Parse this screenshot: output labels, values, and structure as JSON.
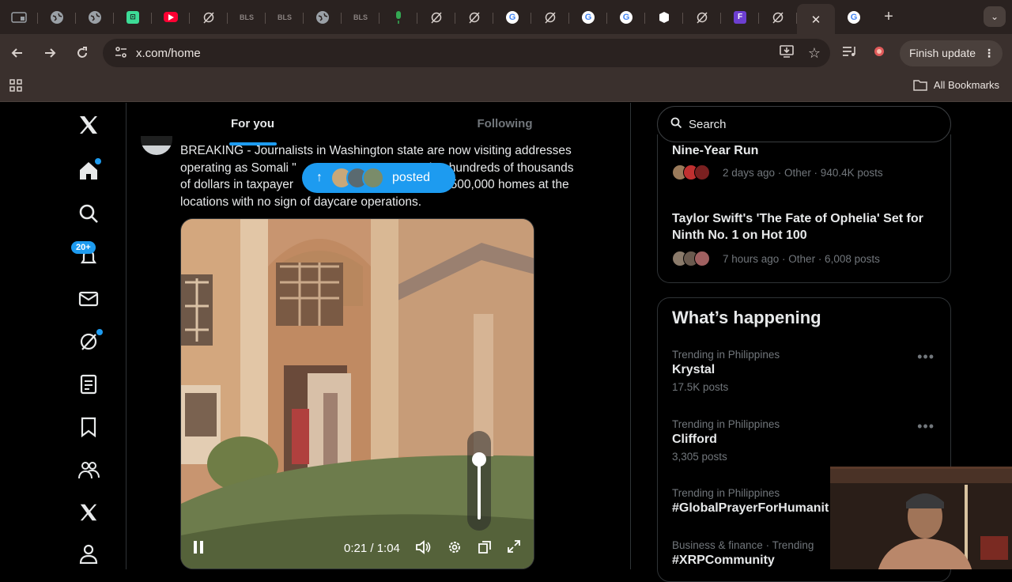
{
  "browser": {
    "tabs": [
      {
        "icon": "tablet-icon",
        "color": "#9aa0a6",
        "text": ""
      },
      {
        "icon": "globe-icon",
        "color": "#9aa0a6",
        "text": ""
      },
      {
        "icon": "globe-icon",
        "color": "#9aa0a6",
        "text": ""
      },
      {
        "icon": "chat-app-icon",
        "color": "#3ddc97",
        "text": ""
      },
      {
        "icon": "youtube-icon",
        "color": "#ff0033",
        "text": ""
      },
      {
        "icon": "grok-icon",
        "color": "#d8d0cc",
        "text": ""
      },
      {
        "icon": "bls-icon",
        "color": "#2a2220",
        "text": "BLS"
      },
      {
        "icon": "bls-icon",
        "color": "#2a2220",
        "text": "BLS"
      },
      {
        "icon": "globe-icon",
        "color": "#9aa0a6",
        "text": ""
      },
      {
        "icon": "bls-icon",
        "color": "#2a2220",
        "text": "BLS"
      },
      {
        "icon": "mic-icon",
        "color": "#34a853",
        "text": ""
      },
      {
        "icon": "grok-icon",
        "color": "#d8d0cc",
        "text": ""
      },
      {
        "icon": "grok-icon",
        "color": "#d8d0cc",
        "text": ""
      },
      {
        "icon": "google-icon",
        "color": "#4285f4",
        "text": ""
      },
      {
        "icon": "grok-icon",
        "color": "#d8d0cc",
        "text": ""
      },
      {
        "icon": "google-icon",
        "color": "#4285f4",
        "text": ""
      },
      {
        "icon": "google-icon",
        "color": "#4285f4",
        "text": ""
      },
      {
        "icon": "cube-icon",
        "color": "#ffffff",
        "text": ""
      },
      {
        "icon": "grok-icon",
        "color": "#d8d0cc",
        "text": ""
      },
      {
        "icon": "app-f-icon",
        "color": "#6d3fd1",
        "text": "F"
      },
      {
        "icon": "grok-icon",
        "color": "#d8d0cc",
        "text": ""
      }
    ],
    "url": "x.com/home",
    "finish_update": "Finish update",
    "all_bookmarks": "All Bookmarks"
  },
  "feed": {
    "tab_for_you": "For you",
    "tab_following": "Following",
    "posted_label": "posted",
    "tweet_line1": "BREAKING - Journalists in Washington state are now visiting addresses",
    "tweet_line2_a": "operating as Somali \"",
    "tweet_line2_b": "ing hundreds of thousands",
    "tweet_line3_a": "of dollars in taxpayer",
    "tweet_line3_b": "$500,000 homes at the",
    "tweet_line4": "locations with no sign of daycare operations.",
    "video_time": "0:21 / 1:04",
    "volume_level": 0.85
  },
  "nav": {
    "notification_badge": "20+"
  },
  "sidebar": {
    "search_placeholder": "Search",
    "news": [
      {
        "title": "Nine-Year Run",
        "meta": "2 days ago · Other · 940.4K posts"
      },
      {
        "title": "Taylor Swift's 'The Fate of Ophelia' Set for Ninth No. 1 on Hot 100",
        "meta": "7 hours ago · Other · 6,008 posts"
      }
    ],
    "whats_happening": "What’s happening",
    "trends": [
      {
        "context": "Trending in Philippines",
        "name": "Krystal",
        "count": "17.5K posts"
      },
      {
        "context": "Trending in Philippines",
        "name": "Clifford",
        "count": "3,305 posts"
      },
      {
        "context": "Trending in Philippines",
        "name": "#GlobalPrayerForHumanit",
        "count": ""
      },
      {
        "context": "Business & finance · Trending",
        "name": "#XRPCommunity",
        "count": ""
      }
    ]
  }
}
